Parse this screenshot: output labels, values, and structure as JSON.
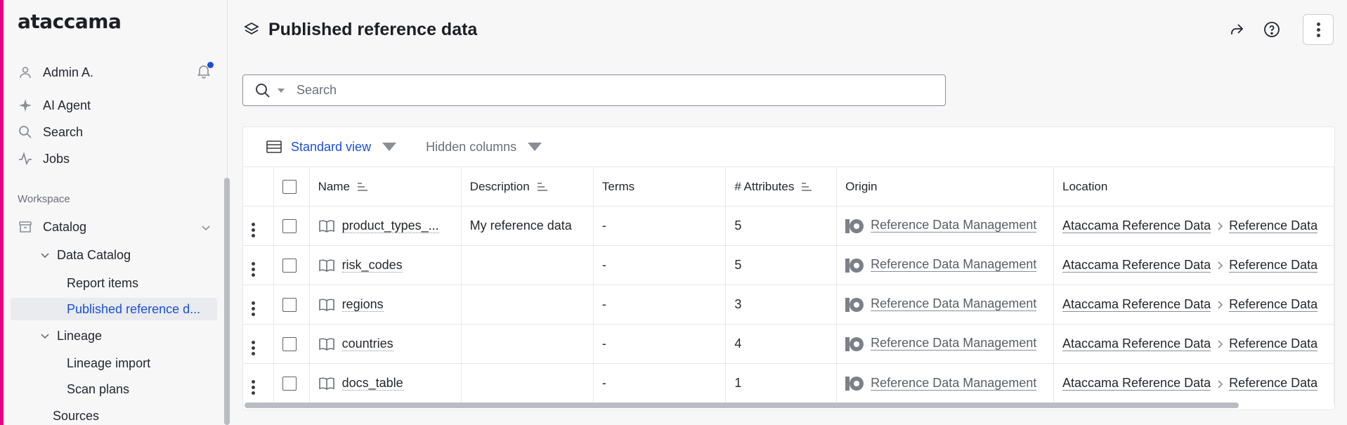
{
  "app": {
    "logo": "ataccama",
    "accent_color": "#e6007e",
    "link_color": "#1a4fd6"
  },
  "sidebar": {
    "user": "Admin A.",
    "notifications_unread": true,
    "top_items": [
      {
        "label": "AI Agent",
        "icon": "sparkle-icon"
      },
      {
        "label": "Search",
        "icon": "search-icon"
      },
      {
        "label": "Jobs",
        "icon": "activity-icon"
      }
    ],
    "section": "Workspace",
    "catalog": "Catalog",
    "data_catalog": "Data Catalog",
    "report_items": "Report items",
    "published_ref": "Published reference d...",
    "lineage": "Lineage",
    "lineage_import": "Lineage import",
    "scan_plans": "Scan plans",
    "sources": "Sources"
  },
  "header": {
    "title": "Published reference data"
  },
  "search": {
    "placeholder": "Search",
    "value": ""
  },
  "toolbar": {
    "view_label": "Standard view",
    "hidden_columns_label": "Hidden columns"
  },
  "table": {
    "columns": {
      "name": "Name",
      "description": "Description",
      "terms": "Terms",
      "attributes": "# Attributes",
      "origin": "Origin",
      "location": "Location"
    },
    "rows": [
      {
        "name": "product_types_...",
        "description": "My reference data",
        "terms": "-",
        "attributes": "5",
        "origin": "Reference Data Management",
        "loc1": "Ataccama Reference Data",
        "loc2": "Reference Data"
      },
      {
        "name": "risk_codes",
        "description": "",
        "terms": "-",
        "attributes": "5",
        "origin": "Reference Data Management",
        "loc1": "Ataccama Reference Data",
        "loc2": "Reference Data"
      },
      {
        "name": "regions",
        "description": "",
        "terms": "-",
        "attributes": "3",
        "origin": "Reference Data Management",
        "loc1": "Ataccama Reference Data",
        "loc2": "Reference Data"
      },
      {
        "name": "countries",
        "description": "",
        "terms": "-",
        "attributes": "4",
        "origin": "Reference Data Management",
        "loc1": "Ataccama Reference Data",
        "loc2": "Reference Data"
      },
      {
        "name": "docs_table",
        "description": "",
        "terms": "-",
        "attributes": "1",
        "origin": "Reference Data Management",
        "loc1": "Ataccama Reference Data",
        "loc2": "Reference Data"
      }
    ]
  }
}
